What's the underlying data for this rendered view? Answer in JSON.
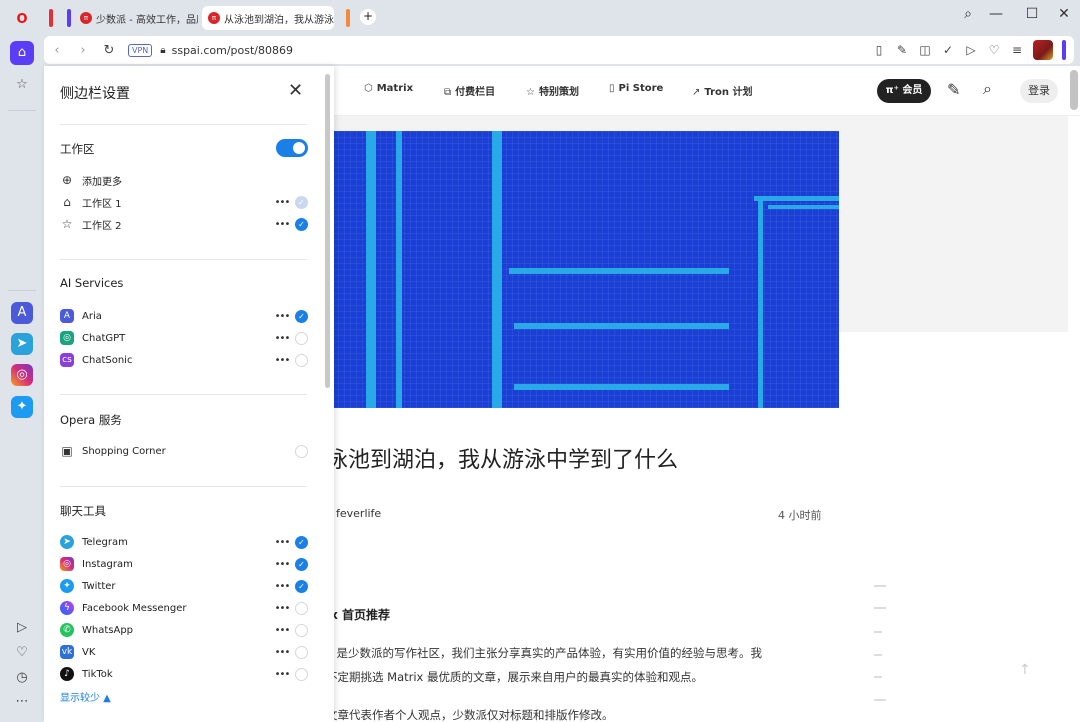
{
  "tabs": [
    {
      "title": "少数派 - 高效工作，品质",
      "active": false
    },
    {
      "title": "从泳池到湖泊，我从游泳中",
      "active": true
    }
  ],
  "window_controls": {
    "search": "⌕",
    "minimize": "—",
    "maximize": "☐",
    "close": "✕"
  },
  "address": {
    "url": "sspai.com/post/80869",
    "vpn": "VPN"
  },
  "sidebar_left": {
    "logo": "O",
    "apps": [
      "aria-icon",
      "telegram-icon",
      "instagram-icon",
      "twitter-icon"
    ],
    "bottom": [
      "player-icon",
      "heart-icon",
      "history-icon",
      "more-icon"
    ]
  },
  "nav": {
    "links": [
      "Matrix",
      "付费栏目",
      "特别策划",
      "Pi Store",
      "Tron 计划"
    ],
    "vip": "π⁺ 会员",
    "login": "登录"
  },
  "article": {
    "title": "泳池到湖泊，我从游泳中学到了什么",
    "author": "feverlife",
    "time": "4 小时前",
    "recommend": "ix 首页推荐",
    "para1": "x  是少数派的写作社区，我们主张分享真实的产品体验，有实用价值的经验与思考。我",
    "para2": "不定期挑选 Matrix 最优质的文章，展示来自用户的最真实的体验和观点。",
    "para3": "文章代表作者个人观点，少数派仅对标题和排版作修改。"
  },
  "panel": {
    "title": "侧边栏设置",
    "workspace": {
      "heading": "工作区",
      "add": "添加更多",
      "items": [
        "工作区 1",
        "工作区 2"
      ]
    },
    "ai": {
      "heading": "AI Services",
      "items": [
        "Aria",
        "ChatGPT",
        "ChatSonic"
      ]
    },
    "opera": {
      "heading": "Opera 服务",
      "items": [
        "Shopping Corner"
      ]
    },
    "chat": {
      "heading": "聊天工具",
      "items": [
        "Telegram",
        "Instagram",
        "Twitter",
        "Facebook Messenger",
        "WhatsApp",
        "VK",
        "TikTok"
      ]
    },
    "show_less": "显示较少 ▲"
  }
}
